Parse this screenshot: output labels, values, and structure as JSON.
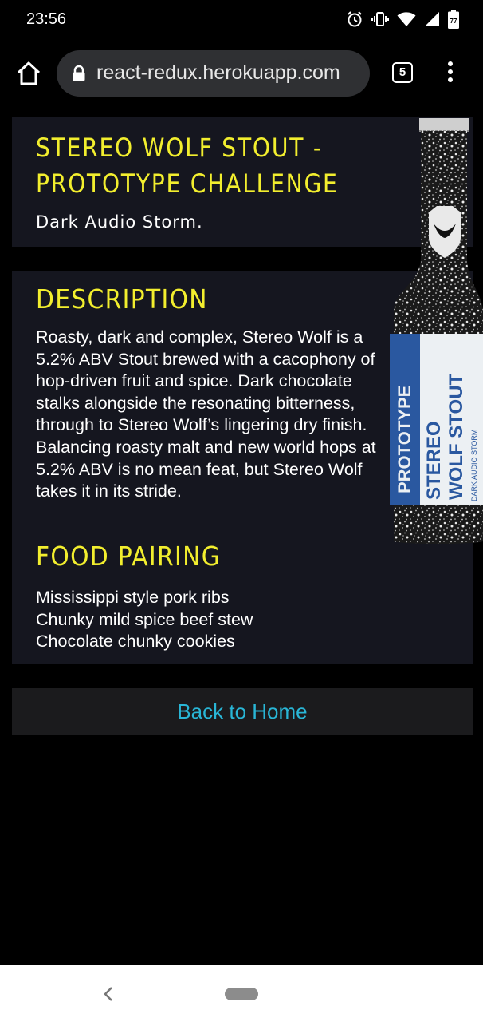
{
  "status_bar": {
    "time": "23:56",
    "battery_level": "77",
    "icons": [
      "alarm-icon",
      "vibrate-icon",
      "wifi-icon",
      "signal-icon",
      "battery-icon"
    ]
  },
  "browser": {
    "url": "react-redux.herokuapp.com",
    "tab_count": "5",
    "icons": [
      "home-icon",
      "lock-icon",
      "tabs-icon",
      "more-vert-icon"
    ]
  },
  "beer": {
    "name": "STEREO WOLF STOUT - PROTOTYPE CHALLENGE",
    "tagline": "Dark Audio Storm.",
    "description_heading": "DESCRIPTION",
    "description": "Roasty, dark and complex, Stereo Wolf is a 5.2% ABV Stout brewed with a cacophony of hop-driven fruit and spice. Dark chocolate stalks alongside the resonating bitterness, through to Stereo Wolf’s lingering dry finish. Balancing roasty malt and new world hops at 5.2% ABV is no mean feat, but Stereo Wolf takes it in its stride.",
    "food_pairing_heading": "FOOD PAIRING",
    "food_pairing": [
      "Mississippi style pork ribs",
      "Chunky mild spice beef stew",
      "Chocolate chunky cookies"
    ],
    "bottle_label": {
      "prototype": "PROTOTYPE",
      "line1": "STEREO",
      "line2": "WOLF STOUT",
      "side_text": "DARK AUDIO STORM"
    }
  },
  "actions": {
    "back_home": "Back to Home"
  },
  "colors": {
    "accent_yellow": "#f2ee2e",
    "link_blue": "#29b6d6",
    "card_bg": "#15161f",
    "page_bg": "#000000"
  }
}
